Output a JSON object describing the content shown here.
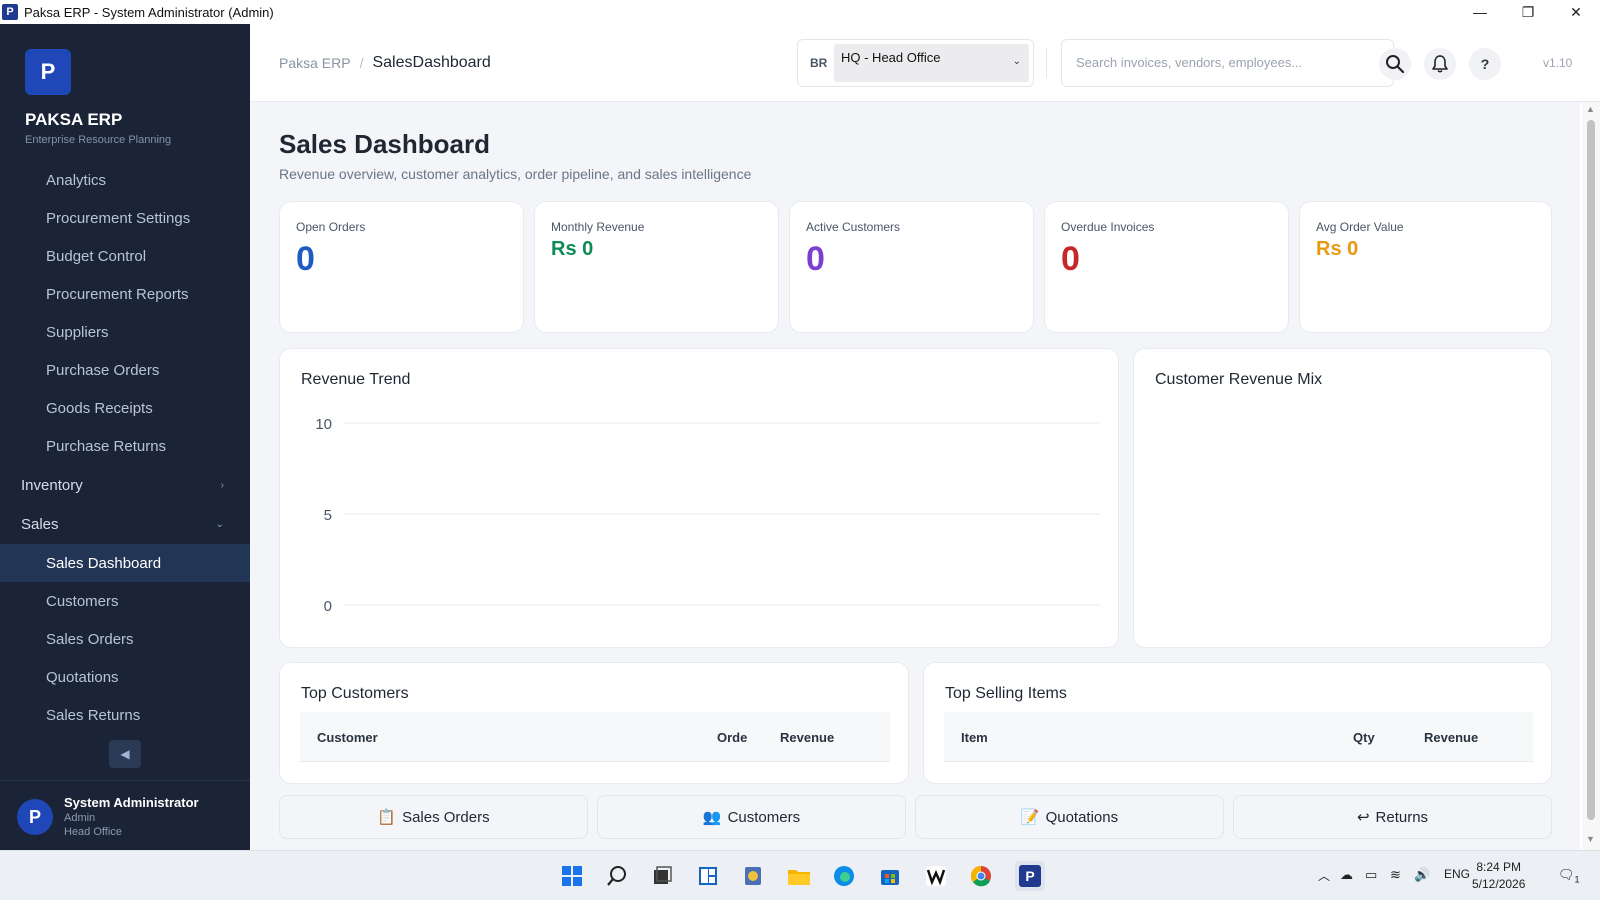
{
  "window": {
    "badge": "P",
    "title": "Paksa ERP - System Administrator (Admin)",
    "minimize": "—",
    "restore": "❐",
    "close": "✕"
  },
  "sidebar": {
    "logo_letter": "P",
    "brand": "PAKSA ERP",
    "tagline": "Enterprise Resource Planning",
    "procurement_items": [
      "Analytics",
      "Procurement Settings",
      "Budget Control",
      "Procurement Reports",
      "Suppliers",
      "Purchase Orders",
      "Goods Receipts",
      "Purchase Returns"
    ],
    "groups": {
      "inventory": "Inventory",
      "sales": "Sales"
    },
    "group_chevrons": {
      "inventory": "›",
      "sales": "⌄"
    },
    "sales_items": [
      "Sales Dashboard",
      "Customers",
      "Sales Orders",
      "Quotations",
      "Sales Returns"
    ],
    "active_item": "Sales Dashboard",
    "collapse_glyph": "◀",
    "user": {
      "initial": "P",
      "name": "System Administrator",
      "role": "Admin",
      "branch": "Head Office"
    }
  },
  "header": {
    "breadcrumb_root": "Paksa ERP",
    "breadcrumb_sep": "/",
    "breadcrumb_current": "SalesDashboard",
    "branch_tag": "BR",
    "branch_value": "HQ - Head Office",
    "branch_caret": "⌄",
    "search_placeholder": "Search invoices, vendors, employees...",
    "help_label": "?",
    "version": "v1.10"
  },
  "page": {
    "title": "Sales Dashboard",
    "subtitle": "Revenue overview, customer analytics, order pipeline, and sales intelligence"
  },
  "kpis": [
    {
      "label": "Open Orders",
      "value": "0",
      "color": "#1f5bc4"
    },
    {
      "label": "Monthly Revenue",
      "value": "Rs 0",
      "color": "#0f8a57"
    },
    {
      "label": "Active Customers",
      "value": "0",
      "color": "#7b3fd1"
    },
    {
      "label": "Overdue Invoices",
      "value": "0",
      "color": "#c62828"
    },
    {
      "label": "Avg Order Value",
      "value": "Rs 0",
      "color": "#e69a12"
    }
  ],
  "revenue_trend": {
    "title": "Revenue Trend",
    "tick_labels": [
      "10",
      "5",
      "0"
    ]
  },
  "chart_data": {
    "type": "line",
    "title": "Revenue Trend",
    "series": [],
    "ylim": [
      0,
      10
    ],
    "yticks": [
      0,
      5,
      10
    ],
    "grid": true
  },
  "revenue_mix": {
    "title": "Customer Revenue Mix"
  },
  "top_customers": {
    "title": "Top Customers",
    "columns": [
      "Customer",
      "Orde",
      "Revenue"
    ]
  },
  "top_items": {
    "title": "Top Selling Items",
    "columns": [
      "Item",
      "Qty",
      "Revenue"
    ]
  },
  "quick_actions": [
    {
      "label": "Sales Orders",
      "icon": "clipboard-icon",
      "glyph": "📋"
    },
    {
      "label": "Customers",
      "icon": "users-icon",
      "glyph": "👥"
    },
    {
      "label": "Quotations",
      "icon": "edit-document-icon",
      "glyph": "📝"
    },
    {
      "label": "Returns",
      "icon": "return-arrow-icon",
      "glyph": "↩"
    }
  ],
  "taskbar": {
    "language": "ENG",
    "time": "8:24 PM",
    "date": "5/12/2026",
    "notification_count": "1"
  }
}
